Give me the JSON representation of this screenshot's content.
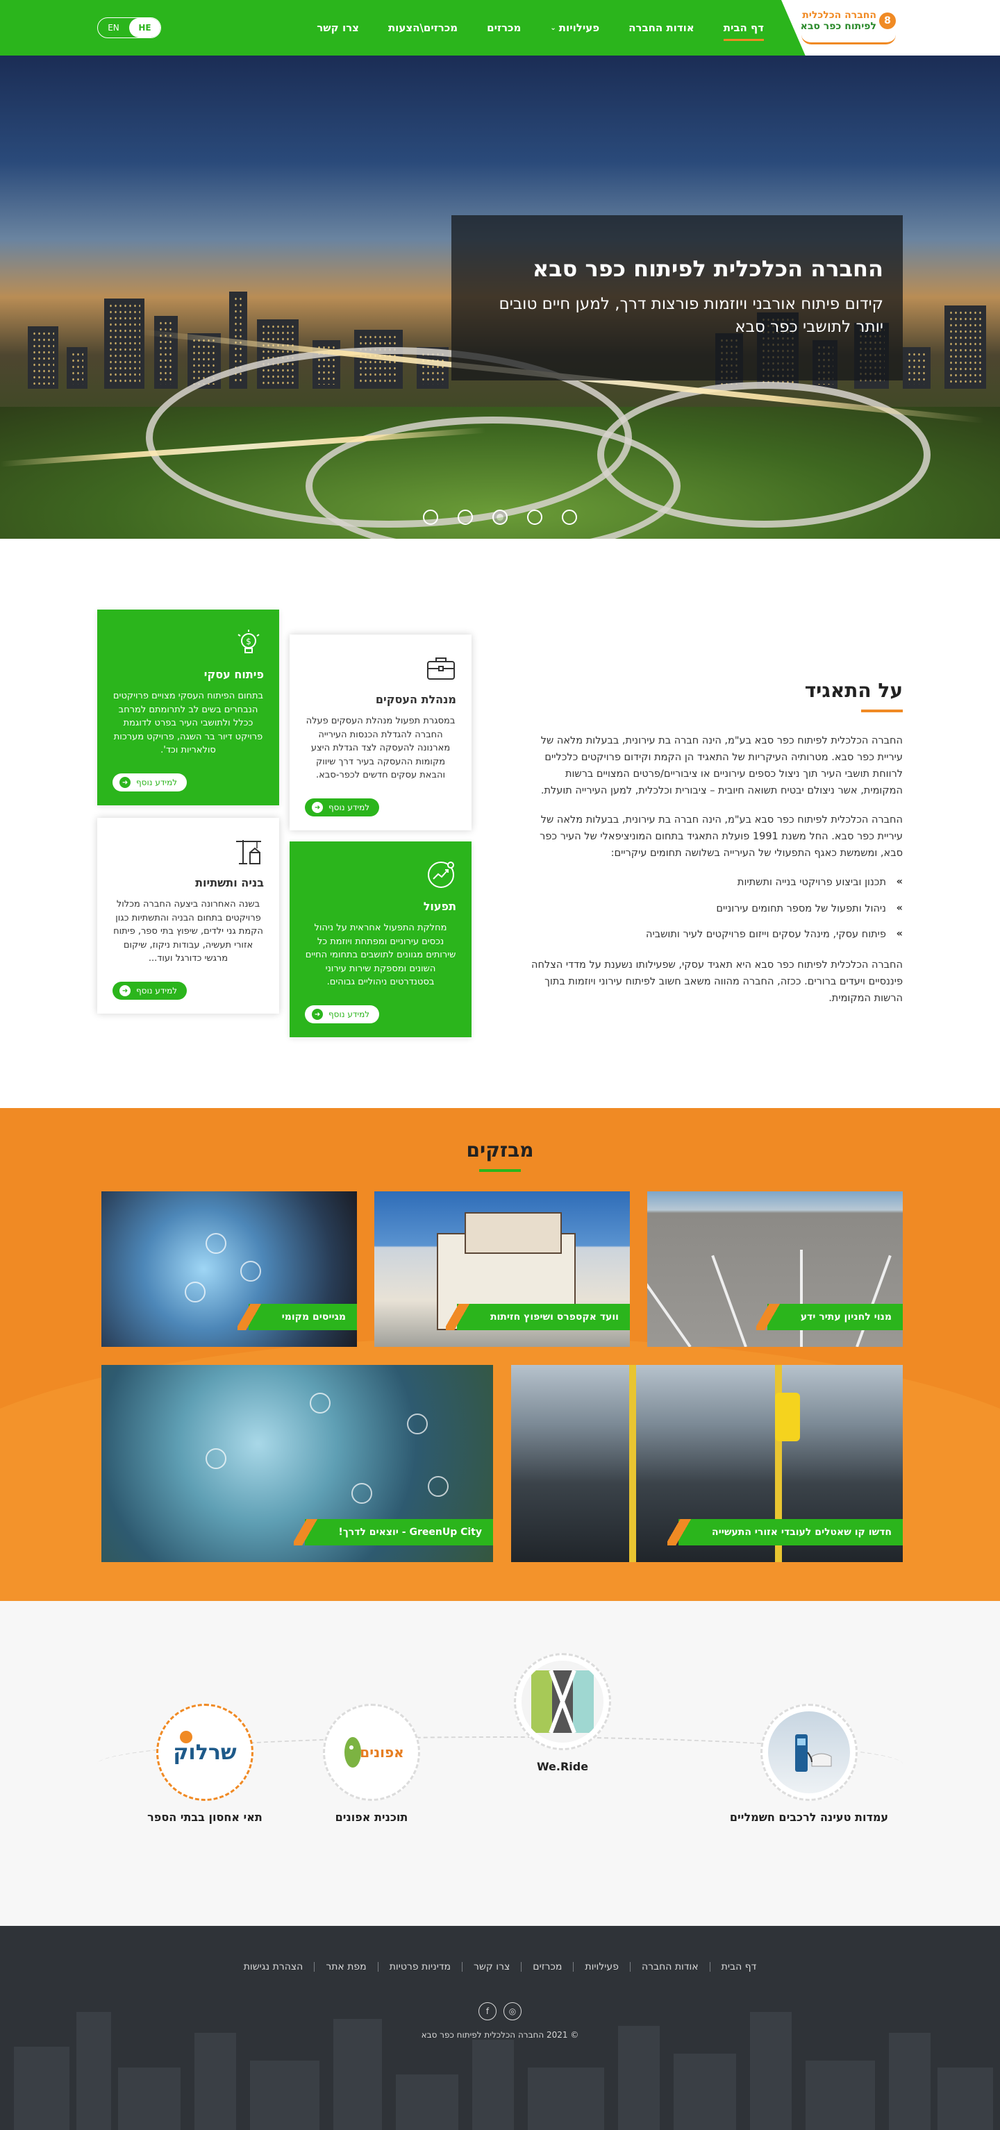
{
  "header": {
    "logo_line1": "החברה הכלכלית",
    "logo_line2": "לפיתוח כפר סבא",
    "logo_mark": "8",
    "nav": [
      {
        "label": "דף הבית",
        "active": true
      },
      {
        "label": "אודות החברה"
      },
      {
        "label": "פעילויות",
        "dropdown": true
      },
      {
        "label": "מכרזים"
      },
      {
        "label": "מכרזים\\הצעות"
      },
      {
        "label": "צרו קשר"
      }
    ],
    "lang_en": "EN",
    "lang_he": "HE"
  },
  "hero": {
    "title": "החברה הכלכלית לפיתוח כפר סבא",
    "subtitle": "קידום פיתוח אורבני ויוזמות פורצות דרך, למען חיים טובים יותר לתושבי כפר סבא",
    "slides_count": 5,
    "active_slide": 3
  },
  "about": {
    "title": "על התאגיד",
    "p1": "החברה הכלכלית לפיתוח כפר סבא בע\"מ, הינה חברה בת עירונית, בבעלות מלאה של עיריית כפר סבא. מטרותיה העיקריות של התאגיד הן הקמת וקידום פרויקטים כלכליים לרווחת תושבי העיר תוך ניצול כספים עירוניים או ציבוריים/פרטים המצויים ברשות המקומית, אשר ניצולם יבטיח תשואה חיובית – ציבורית וכלכלית, למען העירייה תועלת.",
    "p2": "החברה הכלכלית לפיתוח כפר סבא בע\"מ, הינה חברה בת עירונית, בבעלות מלאה של עיריית כפר סבא. החל משנת 1991 פועלת התאגיד בתחום המוניציפאלי של העיר כפר סבא, ומשמשת כאגף התפעולי של העירייה בשלושה תחומים עיקריים:",
    "bullets": [
      "תכנון וביצוע פרויקטי בנייה ותשתיות",
      "ניהול ותפעול של מספר תחומים עירוניים",
      "פיתוח עסקי, מינהל עסקים וייזום פרויקטים לעיר ותושביה"
    ],
    "p3": "החברה הכלכלית לפיתוח כפר סבא היא תאגיד עסקי, שפעילותו נשענת על מדדי הצלחה פיננסיים ויעדים ברורים. ככזה, החברה מהווה משאב חשוב לפיתוח עירוני ויוזמות בתוך הרשות המקומית.",
    "cards": [
      {
        "title": "פיתוח עסקי",
        "desc": "בתחום הפיתוח העסקי מצויים פרויקטים הנבחרים בשים לב לתרומתם למרחב ככלל ולתושבי העיר בפרט לדוגמת פרויקט דיור בר השגה, פרויקט מערכות סולאריות וכד'.",
        "button": "למידע נוסף",
        "icon": "lightbulb-icon"
      },
      {
        "title": "מנהלת העסקים",
        "desc": "במסגרת תפעול מנהלת העסקים פעלה החברה להגדלת הכנסות העירייה מארנונה להעסקה לצד הגדלת היצע מקומות ההעסקה בעיר דרך שיווק והבאת עסקים חדשים לכפר-סבא.",
        "button": "למידע נוסף",
        "icon": "briefcase-icon"
      },
      {
        "title": "בניה ותשתיות",
        "desc": "בשנה האחרונה ביצעה החברה מכלול פרויקטים בתחום הבניה והתשתיות כגון הקמת גני ילדים, שיפוץ בתי ספר, פיתוח אזורי תעשיה, עבודות ניקוז, שיקום מרגשי כדורגל ועוד...",
        "button": "למידע נוסף",
        "icon": "crane-icon"
      },
      {
        "title": "תפעול",
        "desc": "מחלקת התפעול אחראית על ניהול נכסים עירוניים ומפתחת ויוזמת כל שירותים מגוונים לתושבים בתחומי החיים השונים ומספקת שירות עירוני בסטנדרטים ניהוליים גבוהים.",
        "button": "למידע נוסף",
        "icon": "growth-gear-icon"
      }
    ]
  },
  "tenders": {
    "title": "מבזקים",
    "items": [
      "מנוי לחניון עתיר ידע",
      "וועד אקספרס ושיפוץ חזיתות",
      "מגייסים מקומי",
      "חדשו קו שאטלים לעובדי אזורי התעשייה",
      "GreenUp City - יוצאים לדרך!"
    ]
  },
  "projects": {
    "items": [
      {
        "label": "עמדות טעינה לרכבים חשמליים"
      },
      {
        "label": "We.Ride",
        "logo_text": "We.Ride"
      },
      {
        "label": "תוכנית אפונים",
        "logo_text": "אפונים"
      },
      {
        "label": "תאי אחסון בבתי הספר",
        "logo_text": "שרלוק"
      }
    ]
  },
  "footer": {
    "links": [
      "דף הבית",
      "אודות החברה",
      "פעילויות",
      "מכרזים",
      "צרו קשר",
      "מדיניות פרטיות",
      "מפת אתר",
      "הצהרת נגישות"
    ],
    "facebook": "f",
    "instagram": "◎",
    "copyright": "© 2021 החברה הכלכלית לפיתוח כפר סבא"
  },
  "colors": {
    "green": "#2bb51c",
    "orange": "#f08a24",
    "dark": "#2f3338"
  }
}
